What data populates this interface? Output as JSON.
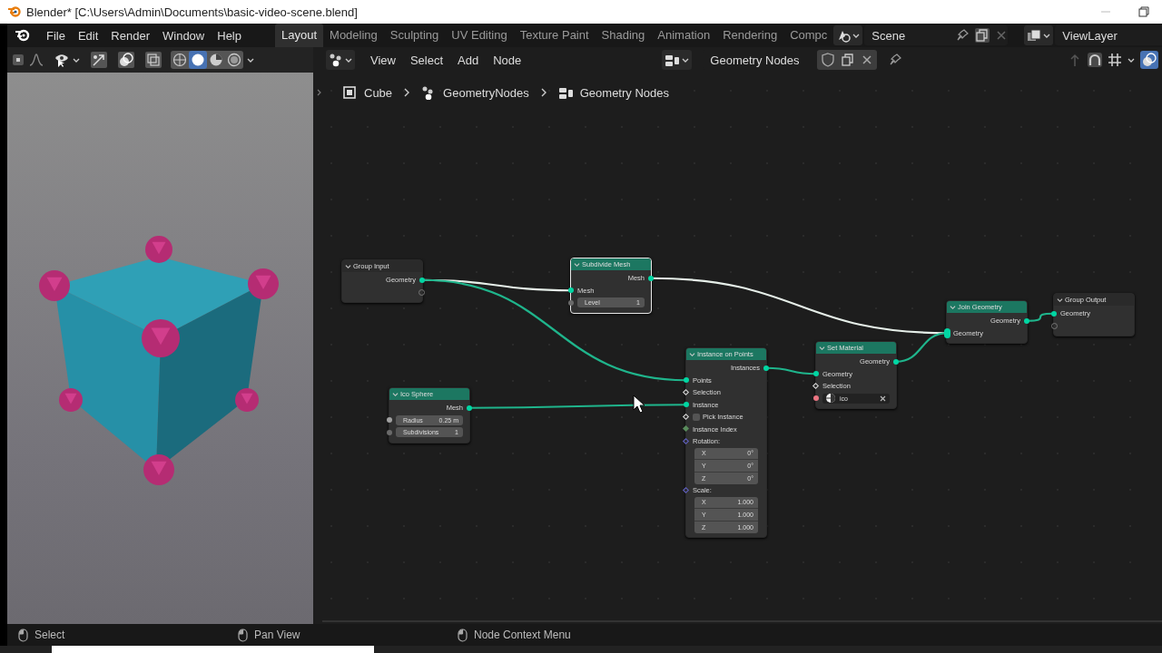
{
  "title_bar": {
    "title": "Blender* [C:\\Users\\Admin\\Documents\\basic-video-scene.blend]"
  },
  "menu": [
    "File",
    "Edit",
    "Render",
    "Window",
    "Help"
  ],
  "workspaces": [
    {
      "label": "Layout",
      "selected": true
    },
    {
      "label": "Modeling",
      "selected": false
    },
    {
      "label": "Sculpting",
      "selected": false
    },
    {
      "label": "UV Editing",
      "selected": false
    },
    {
      "label": "Texture Paint",
      "selected": false
    },
    {
      "label": "Shading",
      "selected": false
    },
    {
      "label": "Animation",
      "selected": false
    },
    {
      "label": "Rendering",
      "selected": false
    },
    {
      "label": "Compc",
      "selected": false
    }
  ],
  "scene": {
    "name": "Scene"
  },
  "view_layer": {
    "name": "ViewLayer"
  },
  "viewport_header": {
    "shading_modes": [
      {
        "kind": "wireframe",
        "selected": false
      },
      {
        "kind": "solid",
        "selected": true
      },
      {
        "kind": "material",
        "selected": false
      },
      {
        "kind": "rendered",
        "selected": false
      }
    ]
  },
  "node_header": {
    "menus": [
      "View",
      "Select",
      "Add",
      "Node"
    ],
    "node_tree": "Geometry Nodes"
  },
  "breadcrumbs": [
    "Cube",
    "GeometryNodes",
    "Geometry Nodes"
  ],
  "nodes": [
    {
      "title": "Group Input",
      "kind": "group",
      "selected": false,
      "rows": [
        {
          "kind": "output",
          "label": "Geometry",
          "socket": {
            "kind": "geometry"
          }
        },
        {
          "kind": "output",
          "socket": {
            "kind": "virtual"
          }
        }
      ]
    },
    {
      "title": "Subdivide Mesh",
      "kind": "geometry",
      "selected": true,
      "rows": [
        {
          "kind": "output",
          "label": "Mesh",
          "socket": {
            "kind": "geometry"
          }
        },
        {
          "kind": "input",
          "label": "Mesh",
          "socket": {
            "kind": "geometry"
          }
        },
        {
          "kind": "value",
          "label": "Level",
          "value": "1",
          "socket": {
            "kind": "integer"
          }
        }
      ]
    },
    {
      "title": "Ico Sphere",
      "kind": "geometry",
      "selected": false,
      "rows": [
        {
          "kind": "output",
          "label": "Mesh",
          "socket": {
            "kind": "geometry"
          }
        },
        {
          "kind": "value",
          "label": "Radius",
          "value": "0.25 m",
          "socket": {
            "kind": "float"
          }
        },
        {
          "kind": "value",
          "label": "Subdivisions",
          "value": "1",
          "socket": {
            "kind": "integer"
          }
        }
      ]
    },
    {
      "title": "Instance on Points",
      "kind": "geometry",
      "selected": false,
      "rows": [
        {
          "kind": "output",
          "label": "Instances",
          "socket": {
            "kind": "geometry"
          }
        },
        {
          "kind": "input",
          "label": "Points",
          "socket": {
            "kind": "geometry"
          }
        },
        {
          "kind": "input",
          "label": "Selection",
          "socket": {
            "kind": "field"
          }
        },
        {
          "kind": "input",
          "label": "Instance",
          "socket": {
            "kind": "geometry"
          }
        },
        {
          "kind": "checkbox",
          "label": "Pick Instance",
          "checked": false,
          "socket": {
            "kind": "field"
          }
        },
        {
          "kind": "input",
          "label": "Instance Index",
          "socket": {
            "kind": "index"
          }
        },
        {
          "kind": "input",
          "label": "Rotation:",
          "socket": {
            "kind": "vector"
          }
        },
        {
          "kind": "vector",
          "label": "X",
          "value": "0°"
        },
        {
          "kind": "vector",
          "label": "Y",
          "value": "0°"
        },
        {
          "kind": "vector",
          "label": "Z",
          "value": "0°"
        },
        {
          "kind": "input",
          "label": "Scale:",
          "socket": {
            "kind": "vector"
          }
        },
        {
          "kind": "vector",
          "label": "X",
          "value": "1.000"
        },
        {
          "kind": "vector",
          "label": "Y",
          "value": "1.000"
        },
        {
          "kind": "vector",
          "label": "Z",
          "value": "1.000"
        }
      ]
    },
    {
      "title": "Set Material",
      "kind": "geometry",
      "selected": false,
      "rows": [
        {
          "kind": "output",
          "label": "Geometry",
          "socket": {
            "kind": "geometry"
          }
        },
        {
          "kind": "input",
          "label": "Geometry",
          "socket": {
            "kind": "geometry"
          }
        },
        {
          "kind": "input",
          "label": "Selection",
          "socket": {
            "kind": "field"
          }
        },
        {
          "kind": "material",
          "value": "ico",
          "socket": {
            "kind": "material"
          }
        }
      ]
    },
    {
      "title": "Join Geometry",
      "kind": "geometry",
      "selected": false,
      "rows": [
        {
          "kind": "output",
          "label": "Geometry",
          "socket": {
            "kind": "geometry"
          }
        },
        {
          "kind": "input",
          "label": "Geometry",
          "socket": {
            "kind": "multi"
          }
        }
      ]
    },
    {
      "title": "Group Output",
      "kind": "group",
      "selected": false,
      "rows": [
        {
          "kind": "input",
          "label": "Geometry",
          "socket": {
            "kind": "geometry"
          }
        },
        {
          "kind": "input",
          "socket": {
            "kind": "virtual"
          }
        }
      ]
    }
  ],
  "status_bar": [
    {
      "label": "Select"
    },
    {
      "label": "Pan View"
    },
    {
      "label": "Node Context Menu"
    }
  ]
}
